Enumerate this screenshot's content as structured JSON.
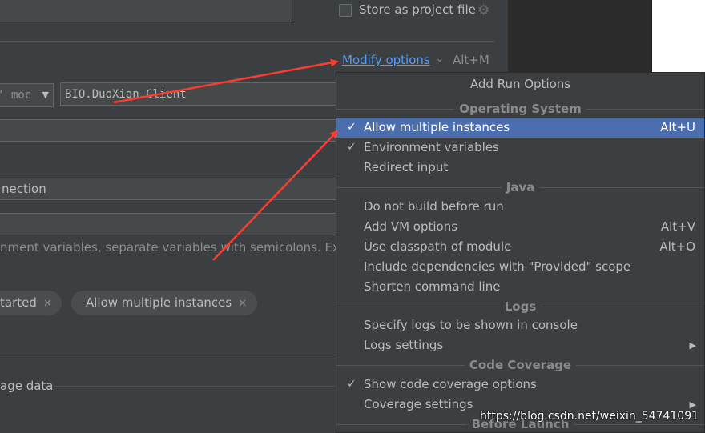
{
  "background": {
    "store_as_project_file_label": "Store as project file",
    "modify_options_link": "Modify options",
    "modify_options_shortcut": "Alt+M",
    "module_combo_text": "' moc",
    "main_class_value": "BIO.DuoXian.Client",
    "field_row_4_text": "nection",
    "env_hint": "nment variables, separate variables with semicolons. Exam",
    "chips": [
      {
        "label": "tarted"
      },
      {
        "label": "Allow multiple instances"
      }
    ],
    "coverage_label": "age data"
  },
  "popup": {
    "title": "Add Run Options",
    "sections": {
      "operating_system": "Operating System",
      "java": "Java",
      "logs": "Logs",
      "code_coverage": "Code Coverage",
      "before_launch": "Before Launch"
    },
    "items": {
      "allow_multiple_instances": {
        "label": "Allow multiple instances",
        "shortcut": "Alt+U",
        "checked": true,
        "selected": true
      },
      "environment_variables": {
        "label": "Environment variables",
        "checked": true
      },
      "redirect_input": {
        "label": "Redirect input"
      },
      "do_not_build": {
        "label": "Do not build before run"
      },
      "add_vm_options": {
        "label": "Add VM options",
        "shortcut": "Alt+V"
      },
      "use_classpath": {
        "label": "Use classpath of module",
        "shortcut": "Alt+O"
      },
      "include_dependencies": {
        "label": "Include dependencies with \"Provided\" scope"
      },
      "shorten_command_line": {
        "label": "Shorten command line"
      },
      "specify_logs": {
        "label": "Specify logs to be shown in console"
      },
      "logs_settings": {
        "label": "Logs settings",
        "submenu": true
      },
      "show_code_coverage": {
        "label": "Show code coverage options",
        "checked": true
      },
      "coverage_settings": {
        "label": "Coverage settings",
        "submenu": true
      }
    }
  },
  "icons": {
    "check": "✓",
    "chip_close": "✕",
    "submenu_arrow": "▶",
    "chevron_down": "⌄",
    "gear": "⚙"
  },
  "colors": {
    "selection": "#4b6eaf",
    "link": "#589df6",
    "annotation_arrow": "#ff3b30"
  },
  "watermark": "https://blog.csdn.net/weixin_54741091"
}
